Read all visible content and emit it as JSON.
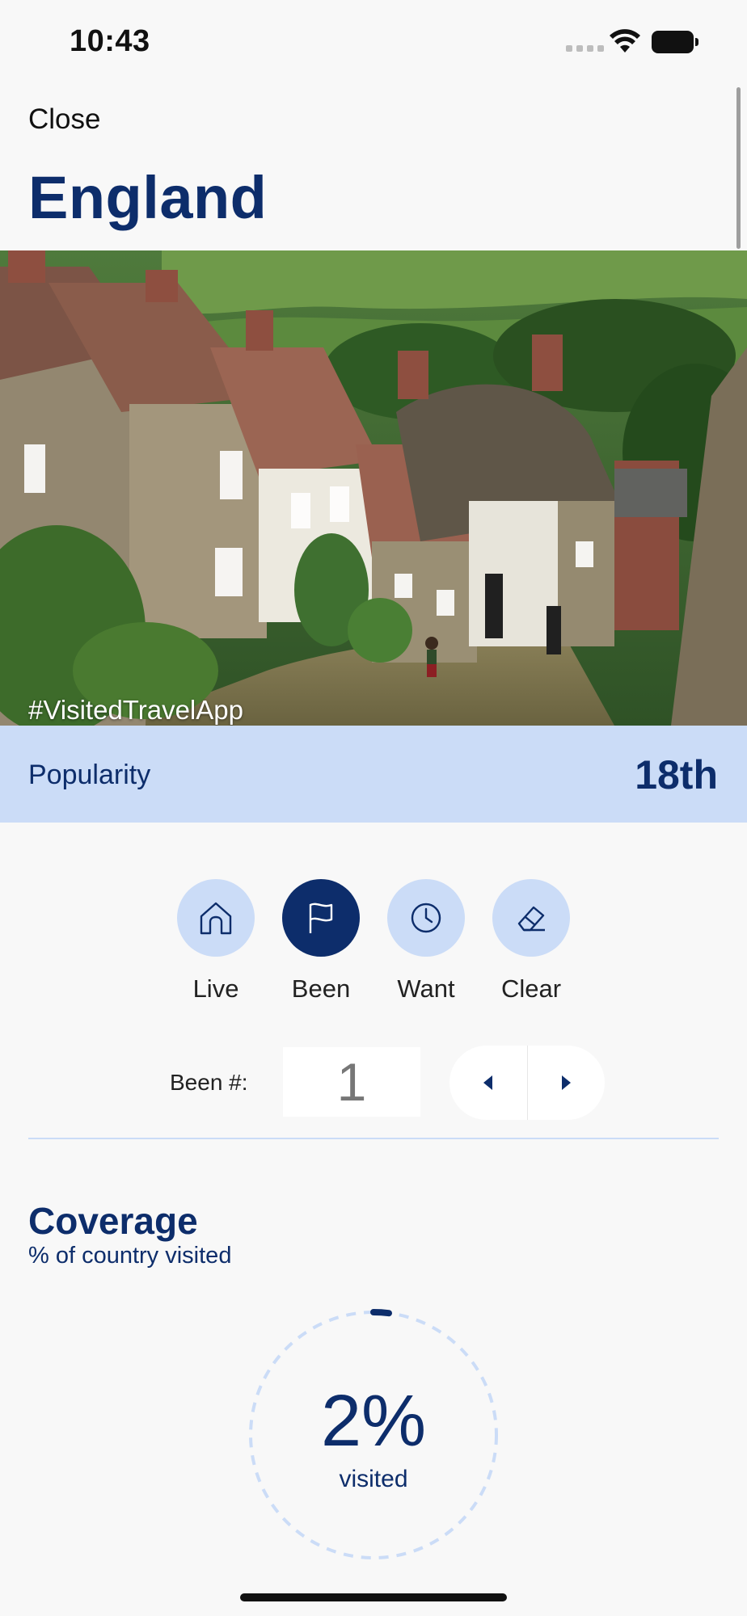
{
  "status_bar": {
    "time": "10:43"
  },
  "header": {
    "close_label": "Close",
    "title": "England"
  },
  "hero": {
    "hashtag": "#VisitedTravelApp",
    "alt": "Thatched cottages on a hillside village street"
  },
  "popularity": {
    "label": "Popularity",
    "value": "18th"
  },
  "status_buttons": [
    {
      "label": "Live",
      "icon": "home-icon",
      "active": false
    },
    {
      "label": "Been",
      "icon": "flag-icon",
      "active": true
    },
    {
      "label": "Want",
      "icon": "clock-icon",
      "active": false
    },
    {
      "label": "Clear",
      "icon": "eraser-icon",
      "active": false
    }
  ],
  "been_count": {
    "label": "Been #:",
    "value": "1"
  },
  "coverage": {
    "title": "Coverage",
    "subtitle": "% of country visited",
    "percent_label": "2%",
    "caption": "visited",
    "percent": 2
  },
  "colors": {
    "primary": "#0d2d6b",
    "accent_light": "#cbdcf7",
    "background": "#f8f8f8"
  }
}
